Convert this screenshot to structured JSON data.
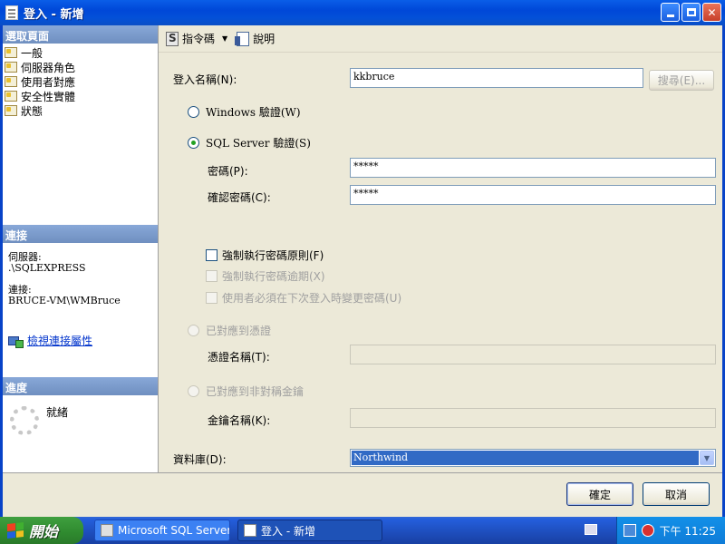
{
  "window": {
    "title": "登入 - 新增"
  },
  "left": {
    "select_page_head": "選取頁面",
    "pages": [
      "一般",
      "伺服器角色",
      "使用者對應",
      "安全性實體",
      "狀態"
    ],
    "connection_head": "連接",
    "server_label": "伺服器:",
    "server_value": ".\\SQLEXPRESS",
    "connection_label": "連接:",
    "connection_value": "BRUCE-VM\\WMBruce",
    "view_link": "檢視連接屬性",
    "progress_head": "進度",
    "progress_status": "就緒"
  },
  "toolbar": {
    "script": "指令碼",
    "help": "說明"
  },
  "form": {
    "login_name_label": "登入名稱(N):",
    "login_name_value": "kkbruce",
    "search_button": "搜尋(E)...",
    "windows_auth": "Windows 驗證(W)",
    "sql_auth": "SQL Server 驗證(S)",
    "password_label": "密碼(P):",
    "password_value": "*****",
    "confirm_label": "確認密碼(C):",
    "confirm_value": "*****",
    "enforce_policy": "強制執行密碼原則(F)",
    "enforce_expiration": "強制執行密碼逾期(X)",
    "must_change": "使用者必須在下次登入時變更密碼(U)",
    "map_cert": "已對應到憑證",
    "cert_name_label": "憑證名稱(T):",
    "map_key": "已對應到非對稱金鑰",
    "key_name_label": "金鑰名稱(K):",
    "db_label": "資料庫(D):",
    "db_value": "Northwind"
  },
  "buttons": {
    "ok": "確定",
    "cancel": "取消"
  },
  "taskbar": {
    "start": "開始",
    "task1": "Microsoft SQL Server ...",
    "task2": "登入 - 新增",
    "clock": "下午 11:25"
  }
}
